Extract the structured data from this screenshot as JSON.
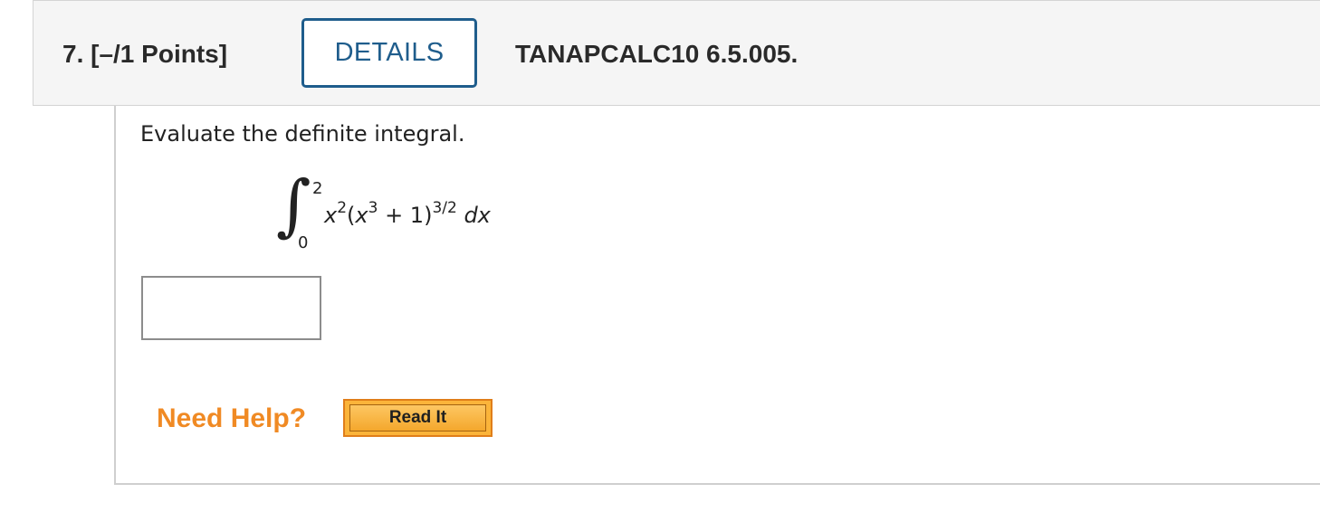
{
  "question": {
    "number_points": "7.  [–/1 Points]",
    "details_label": "DETAILS",
    "code": "TANAPCALC10 6.5.005."
  },
  "problem": {
    "prompt": "Evaluate the definite integral.",
    "integral": {
      "upper_limit": "2",
      "lower_limit": "0",
      "x": "x",
      "exp_2": "2",
      "open_paren": "(",
      "exp_3": "3",
      "plus_one": " + 1)",
      "exp_3_2": "3/2",
      "dx": "dx"
    },
    "answer_value": ""
  },
  "help": {
    "label": "Need Help?",
    "read_it_label": "Read It"
  },
  "colors": {
    "details_border": "#1f5d8c",
    "need_help": "#f08a24",
    "read_it_bg": "#fbb43a"
  }
}
